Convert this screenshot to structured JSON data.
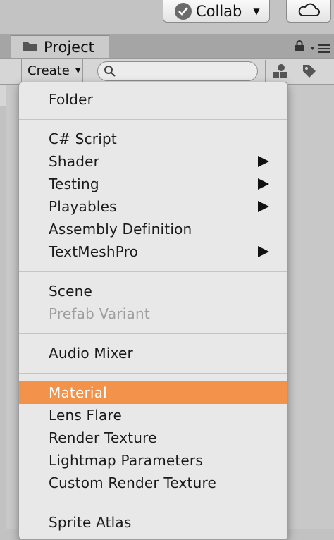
{
  "toolbar": {
    "collab_label": "Collab"
  },
  "tab": {
    "project_label": "Project"
  },
  "project_toolbar": {
    "create_label": "Create",
    "search_value": ""
  },
  "menu": {
    "items": [
      {
        "label": "Folder",
        "enabled": true,
        "submenu": false
      },
      {
        "label": "C# Script",
        "enabled": true,
        "submenu": false
      },
      {
        "label": "Shader",
        "enabled": true,
        "submenu": true
      },
      {
        "label": "Testing",
        "enabled": true,
        "submenu": true
      },
      {
        "label": "Playables",
        "enabled": true,
        "submenu": true
      },
      {
        "label": "Assembly Definition",
        "enabled": true,
        "submenu": false
      },
      {
        "label": "TextMeshPro",
        "enabled": true,
        "submenu": true
      },
      {
        "label": "Scene",
        "enabled": true,
        "submenu": false
      },
      {
        "label": "Prefab Variant",
        "enabled": false,
        "submenu": false
      },
      {
        "label": "Audio Mixer",
        "enabled": true,
        "submenu": false
      },
      {
        "label": "Material",
        "enabled": true,
        "submenu": false,
        "highlighted": true
      },
      {
        "label": "Lens Flare",
        "enabled": true,
        "submenu": false
      },
      {
        "label": "Render Texture",
        "enabled": true,
        "submenu": false
      },
      {
        "label": "Lightmap Parameters",
        "enabled": true,
        "submenu": false
      },
      {
        "label": "Custom Render Texture",
        "enabled": true,
        "submenu": false
      },
      {
        "label": "Sprite Atlas",
        "enabled": true,
        "submenu": false
      }
    ]
  },
  "colors": {
    "highlight": "#f3924a",
    "disabled_text": "#9e9e9e",
    "menu_bg": "#e8e8e8"
  }
}
